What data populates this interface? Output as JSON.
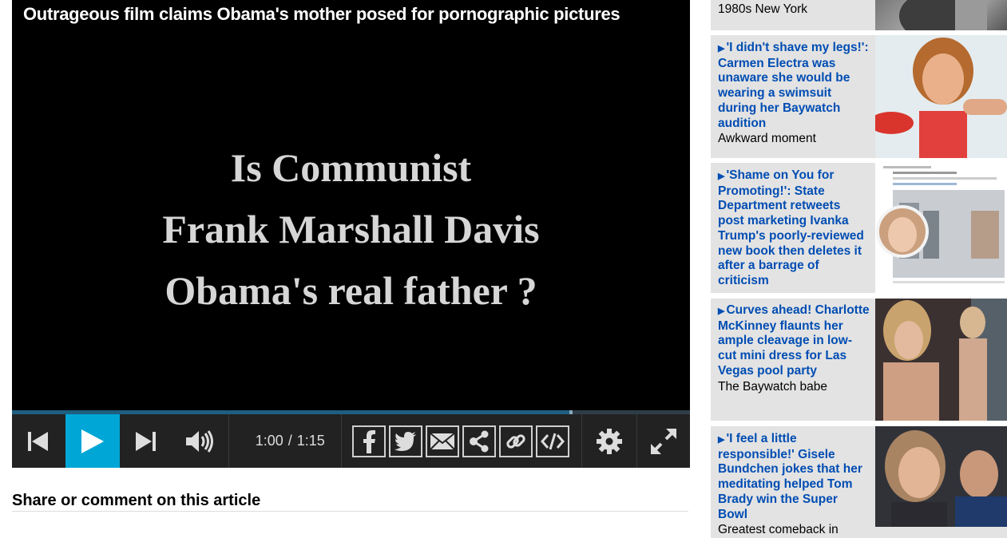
{
  "player": {
    "title": "Outrageous film claims Obama's mother posed for pornographic pictures",
    "slide_lines": [
      "Is Communist",
      "Frank Marshall Davis",
      "Obama's real father ?"
    ],
    "time_current": "1:00",
    "time_separator": "/",
    "time_total": "1:15",
    "progress": 0.8,
    "accent_color": "#00a6d6",
    "icons": [
      "skip-back-icon",
      "play-icon",
      "skip-forward-icon",
      "volume-icon",
      "facebook-icon",
      "twitter-icon",
      "email-icon",
      "share-icon",
      "link-icon",
      "embed-icon",
      "gear-icon",
      "fullscreen-icon"
    ]
  },
  "share_section": {
    "heading": "Share or comment on this article"
  },
  "sidebar": {
    "items": [
      {
        "headline": "",
        "caption": "1980s New York"
      },
      {
        "headline": "'I didn't shave my legs!': Carmen Electra was unaware she would be wearing a swimsuit during her Baywatch audition",
        "caption": "Awkward moment"
      },
      {
        "headline": "'Shame on You for Promoting!': State Department retweets post marketing Ivanka Trump's poorly-reviewed new book then deletes it after a barrage of criticism",
        "caption": ""
      },
      {
        "headline": "Curves ahead! Charlotte McKinney flaunts her ample cleavage in low-cut mini dress for Las Vegas pool party",
        "caption": "The Baywatch babe"
      },
      {
        "headline": "'I feel a little responsible!' Gisele Bundchen jokes that her meditating helped Tom Brady win the Super Bowl",
        "caption": "Greatest comeback in"
      }
    ],
    "link_color": "#004db3"
  }
}
